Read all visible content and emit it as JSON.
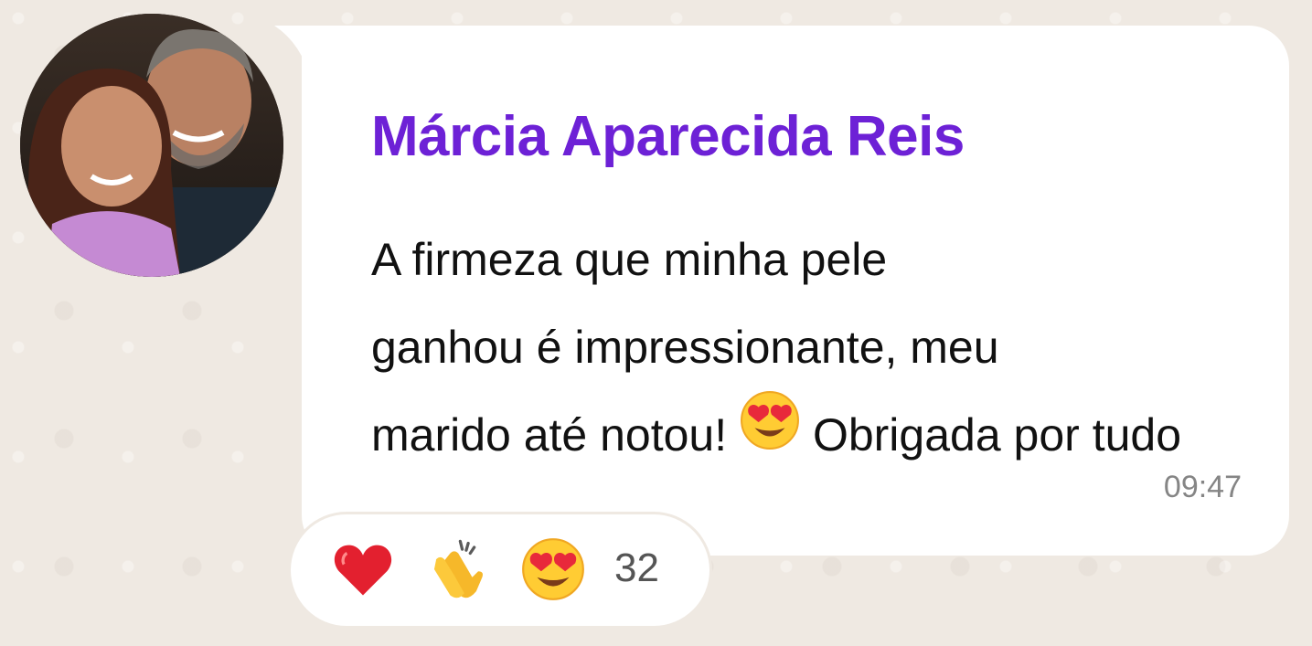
{
  "message": {
    "sender_name": "Márcia Aparecida Reis",
    "text_lines": [
      "A firmeza que minha pele",
      "ganhou é impressionante, meu",
      "marido até notou!"
    ],
    "text_after_emoji": "Obrigada por tudo",
    "inline_emoji": "heart-eyes-emoji",
    "time": "09:47"
  },
  "reactions": {
    "items": [
      "heart-emoji",
      "clapping-hands-emoji",
      "heart-eyes-emoji"
    ],
    "count": "32"
  },
  "colors": {
    "sender_name": "#6d21d6",
    "background": "#efe9e2",
    "bubble": "#ffffff",
    "timestamp": "#858585"
  }
}
